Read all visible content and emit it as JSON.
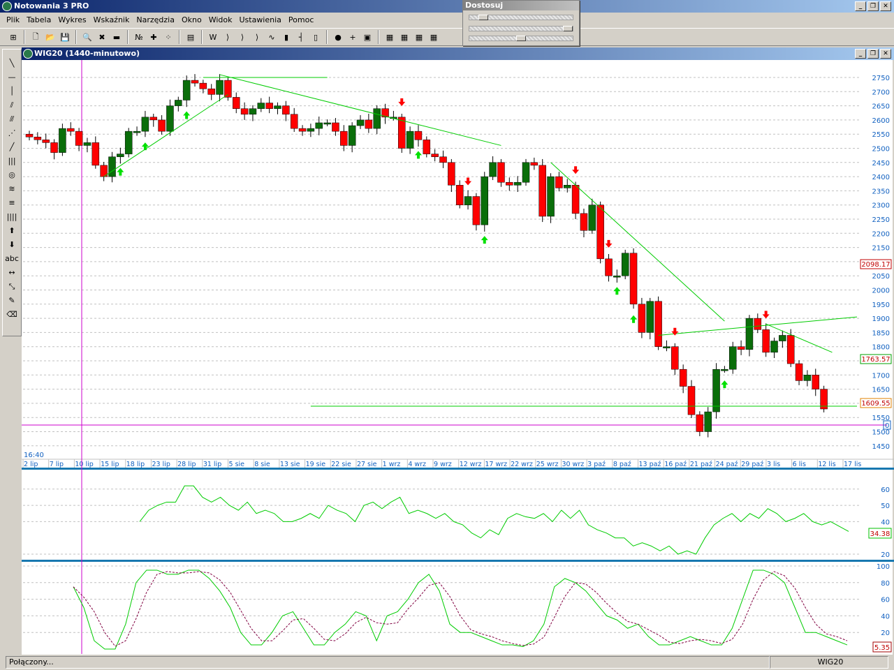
{
  "app": {
    "title": "Notowania 3 PRO"
  },
  "menu": [
    "Plik",
    "Tabela",
    "Wykres",
    "Wskaźnik",
    "Narzędzia",
    "Okno",
    "Widok",
    "Ustawienia",
    "Pomoc"
  ],
  "toolbar_icons": [
    "layout-icon",
    "new-file-icon",
    "open-folder-icon",
    "save-icon",
    "zoom-icon",
    "delete-icon",
    "ruler-icon",
    "numbers-icon",
    "crosshair-icon",
    "dots-icon",
    "table-icon",
    "wl-icon",
    "wave-icon",
    "wave2-icon",
    "wave3-icon",
    "line-chart-icon",
    "bar-chart-icon",
    "ohlc-icon",
    "candle-icon",
    "traffic-light-icon",
    "add-indicator-icon",
    "indicator-window-icon",
    "grid1-icon",
    "grid2-icon",
    "grid3-icon",
    "grid4-icon"
  ],
  "panel": {
    "title": "Dostosuj",
    "slider_values": [
      0.1,
      1.0,
      0.5
    ]
  },
  "left_tools": [
    "╲",
    "—",
    "│",
    "⫽",
    "⫻",
    "⋰",
    "╱",
    "|||",
    "◎",
    "≋",
    "≡",
    "||||",
    "⬆",
    "⬇",
    "abc",
    "↔",
    "⤡",
    "✎",
    "⌫"
  ],
  "window": {
    "title": "WIG20 (1440-minutowo)"
  },
  "time_label": "16:40",
  "status": {
    "left": "Połączony...",
    "right": "WIG20"
  },
  "colors": {
    "up": "#0a6e0a",
    "down": "#ff0000",
    "line": "#00cc00",
    "axis": "#1060c0",
    "marker": "#cc00cc"
  },
  "chart_data": [
    {
      "type": "candlestick",
      "name": "WIG20",
      "ylim": [
        1430,
        2790
      ],
      "yticks": [
        2750,
        2700,
        2650,
        2600,
        2550,
        2500,
        2450,
        2400,
        2350,
        2300,
        2250,
        2200,
        2150,
        2100,
        2050,
        2000,
        1950,
        1900,
        1850,
        1800,
        1750,
        1700,
        1650,
        1600,
        1550,
        1500,
        1450
      ],
      "xticks": [
        "2 lip",
        "7 lip",
        "10 lip",
        "15 lip",
        "18 lip",
        "23 lip",
        "28 lip",
        "31 lip",
        "5 sie",
        "8 sie",
        "13 sie",
        "19 sie",
        "22 sie",
        "27 sie",
        "1 wrz",
        "4 wrz",
        "9 wrz",
        "12 wrz",
        "17 wrz",
        "22 wrz",
        "25 wrz",
        "30 wrz",
        "3 paź",
        "8 paź",
        "13 paź",
        "16 paź",
        "21 paź",
        "24 paź",
        "29 paź",
        "3 lis",
        "6 lis",
        "12 lis",
        "17 lis"
      ],
      "close": [
        2540,
        2530,
        2520,
        2485,
        2570,
        2560,
        2510,
        2520,
        2440,
        2400,
        2470,
        2480,
        2560,
        2560,
        2610,
        2600,
        2560,
        2650,
        2670,
        2740,
        2730,
        2710,
        2690,
        2740,
        2680,
        2640,
        2620,
        2640,
        2660,
        2640,
        2650,
        2620,
        2570,
        2560,
        2570,
        2590,
        2590,
        2560,
        2510,
        2580,
        2600,
        2570,
        2640,
        2610,
        2610,
        2500,
        2560,
        2530,
        2480,
        2470,
        2450,
        2370,
        2300,
        2330,
        2230,
        2400,
        2450,
        2380,
        2370,
        2380,
        2450,
        2440,
        2260,
        2400,
        2360,
        2370,
        2270,
        2210,
        2300,
        2110,
        2050,
        2050,
        2130,
        1950,
        1850,
        1960,
        1800,
        1800,
        1720,
        1660,
        1560,
        1500,
        1570,
        1720,
        1720,
        1800,
        1790,
        1900,
        1860,
        1780,
        1820,
        1840,
        1740,
        1680,
        1700,
        1650,
        1580
      ],
      "value_labels": [
        "2098.17",
        "1763.57",
        "1609.55"
      ],
      "trendlines": [
        [
          9,
          2400,
          24,
          2690
        ],
        [
          21,
          2750,
          36,
          2750
        ],
        [
          23,
          2760,
          57,
          2510
        ],
        [
          63,
          2450,
          84,
          1890
        ],
        [
          76,
          1840,
          100,
          1905
        ],
        [
          89,
          1880,
          97,
          1780
        ],
        [
          34,
          1590,
          100,
          1590
        ]
      ],
      "crosshair": {
        "index": 6,
        "price": 1520,
        "label": "0"
      },
      "up_arrows": [
        11,
        14,
        19,
        47,
        55,
        73,
        71,
        84
      ],
      "down_arrows": [
        45,
        53,
        66,
        70,
        78,
        89
      ]
    },
    {
      "type": "line",
      "name": "RSI",
      "ylim": [
        15,
        70
      ],
      "yticks": [
        60,
        50,
        40,
        20
      ],
      "last": "34.38",
      "values": [
        40,
        47,
        50,
        52,
        52,
        62,
        62,
        55,
        52,
        55,
        50,
        47,
        52,
        45,
        47,
        45,
        40,
        40,
        42,
        45,
        42,
        50,
        47,
        45,
        40,
        50,
        52,
        48,
        52,
        55,
        45,
        47,
        45,
        42,
        45,
        40,
        38,
        33,
        30,
        35,
        32,
        42,
        45,
        43,
        42,
        45,
        40,
        47,
        42,
        47,
        38,
        35,
        33,
        30,
        30,
        25,
        27,
        25,
        22,
        25,
        20,
        22,
        20,
        30,
        38,
        42,
        45,
        40,
        45,
        42,
        48,
        45,
        40,
        42,
        45,
        40,
        38,
        40,
        37,
        34
      ]
    },
    {
      "type": "line",
      "name": "Stochastic",
      "ylim": [
        0,
        100
      ],
      "yticks": [
        100,
        80,
        60,
        40,
        20
      ],
      "last": "5.35",
      "values": [
        75,
        50,
        10,
        0,
        0,
        30,
        80,
        95,
        95,
        90,
        90,
        95,
        95,
        85,
        70,
        50,
        20,
        5,
        5,
        20,
        40,
        45,
        25,
        5,
        5,
        20,
        30,
        45,
        40,
        10,
        40,
        45,
        60,
        80,
        90,
        70,
        30,
        20,
        20,
        15,
        10,
        5,
        5,
        3,
        10,
        30,
        75,
        85,
        80,
        70,
        55,
        40,
        35,
        25,
        30,
        15,
        5,
        5,
        10,
        15,
        10,
        5,
        5,
        25,
        60,
        95,
        95,
        90,
        80,
        50,
        20,
        20,
        15,
        10,
        5
      ]
    }
  ]
}
